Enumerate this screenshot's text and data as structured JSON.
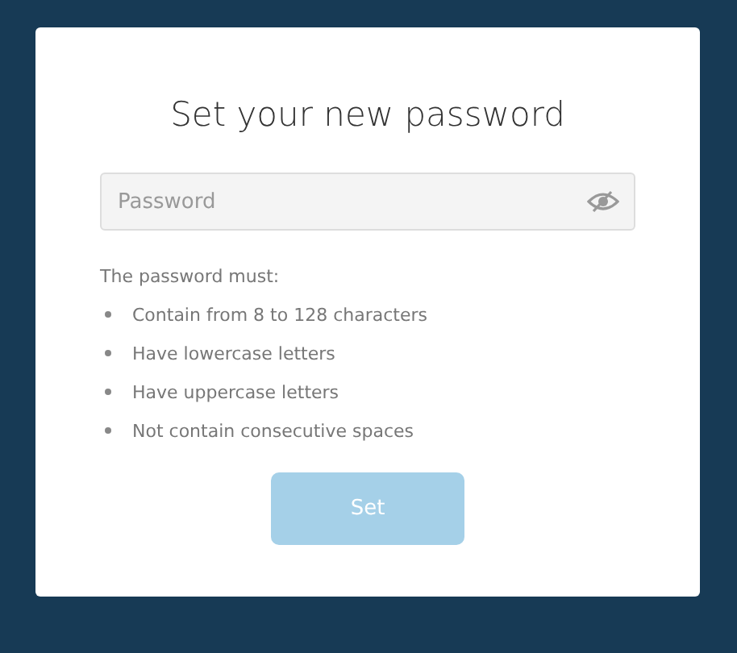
{
  "title": "Set your new password",
  "password_field": {
    "placeholder": "Password",
    "revealed": false
  },
  "rules": {
    "heading": "The password must:",
    "items": [
      "Contain from 8 to 128 characters",
      "Have lowercase letters",
      "Have uppercase letters",
      "Not contain consecutive spaces"
    ]
  },
  "submit_button": {
    "label": "Set",
    "disabled": true
  }
}
